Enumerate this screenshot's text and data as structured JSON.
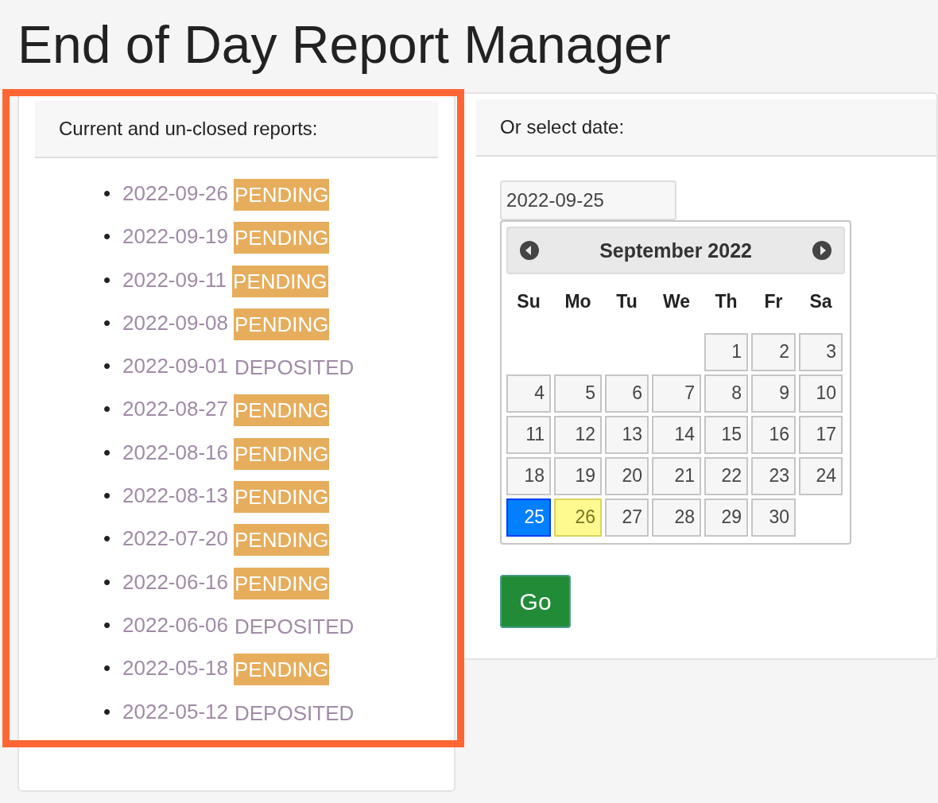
{
  "page_title": "End of Day Report Manager",
  "reports_panel": {
    "heading": "Current and un-closed reports:",
    "reports": [
      {
        "bullet": "•",
        "date": "2022-09-26",
        "status": "PENDING",
        "kind": "pending"
      },
      {
        "bullet": "•",
        "date": "2022-09-19",
        "status": "PENDING",
        "kind": "pending"
      },
      {
        "bullet": "•",
        "date": "2022-09-11",
        "status": "PENDING",
        "kind": "pending"
      },
      {
        "bullet": "•",
        "date": "2022-09-08",
        "status": "PENDING",
        "kind": "pending"
      },
      {
        "bullet": "•",
        "date": "2022-09-01",
        "status": "DEPOSITED",
        "kind": "deposited"
      },
      {
        "bullet": "•",
        "date": "2022-08-27",
        "status": "PENDING",
        "kind": "pending"
      },
      {
        "bullet": "•",
        "date": "2022-08-16",
        "status": "PENDING",
        "kind": "pending"
      },
      {
        "bullet": "•",
        "date": "2022-08-13",
        "status": "PENDING",
        "kind": "pending"
      },
      {
        "bullet": "•",
        "date": "2022-07-20",
        "status": "PENDING",
        "kind": "pending"
      },
      {
        "bullet": "•",
        "date": "2022-06-16",
        "status": "PENDING",
        "kind": "pending"
      },
      {
        "bullet": "•",
        "date": "2022-06-06",
        "status": "DEPOSITED",
        "kind": "deposited"
      },
      {
        "bullet": "•",
        "date": "2022-05-18",
        "status": "PENDING",
        "kind": "pending"
      },
      {
        "bullet": "•",
        "date": "2022-05-12",
        "status": "DEPOSITED",
        "kind": "deposited"
      }
    ],
    "highlighted": true
  },
  "date_panel": {
    "heading": "Or select date:",
    "date_field": {
      "value": "2022-09-25"
    },
    "calendar": {
      "month": "September 2022",
      "weekdays": [
        "Su",
        "Mo",
        "Tu",
        "We",
        "Th",
        "Fr",
        "Sa"
      ],
      "weeks": [
        {
          "days": [
            {
              "day": "1",
              "selected": false,
              "today": false
            },
            {
              "day": "2",
              "selected": false,
              "today": false
            },
            {
              "day": "3",
              "selected": false,
              "today": false
            }
          ]
        },
        {
          "days": [
            {
              "day": "4",
              "selected": false,
              "today": false
            },
            {
              "day": "5",
              "selected": false,
              "today": false
            },
            {
              "day": "6",
              "selected": false,
              "today": false
            },
            {
              "day": "7",
              "selected": false,
              "today": false
            },
            {
              "day": "8",
              "selected": false,
              "today": false
            },
            {
              "day": "9",
              "selected": false,
              "today": false
            },
            {
              "day": "10",
              "selected": false,
              "today": false
            }
          ]
        },
        {
          "days": [
            {
              "day": "11",
              "selected": false,
              "today": false
            },
            {
              "day": "12",
              "selected": false,
              "today": false
            },
            {
              "day": "13",
              "selected": false,
              "today": false
            },
            {
              "day": "14",
              "selected": false,
              "today": false
            },
            {
              "day": "15",
              "selected": false,
              "today": false
            },
            {
              "day": "16",
              "selected": false,
              "today": false
            },
            {
              "day": "17",
              "selected": false,
              "today": false
            }
          ]
        },
        {
          "days": [
            {
              "day": "18",
              "selected": false,
              "today": false
            },
            {
              "day": "19",
              "selected": false,
              "today": false
            },
            {
              "day": "20",
              "selected": false,
              "today": false
            },
            {
              "day": "21",
              "selected": false,
              "today": false
            },
            {
              "day": "22",
              "selected": false,
              "today": false
            },
            {
              "day": "23",
              "selected": false,
              "today": false
            },
            {
              "day": "24",
              "selected": false,
              "today": false
            }
          ]
        },
        {
          "days": [
            {
              "day": "25",
              "selected": true,
              "today": false
            },
            {
              "day": "26",
              "selected": false,
              "today": true
            },
            {
              "day": "27",
              "selected": false,
              "today": false
            },
            {
              "day": "28",
              "selected": false,
              "today": false
            },
            {
              "day": "29",
              "selected": false,
              "today": false
            },
            {
              "day": "30",
              "selected": false,
              "today": false
            }
          ]
        }
      ]
    },
    "go_button": "Go"
  }
}
